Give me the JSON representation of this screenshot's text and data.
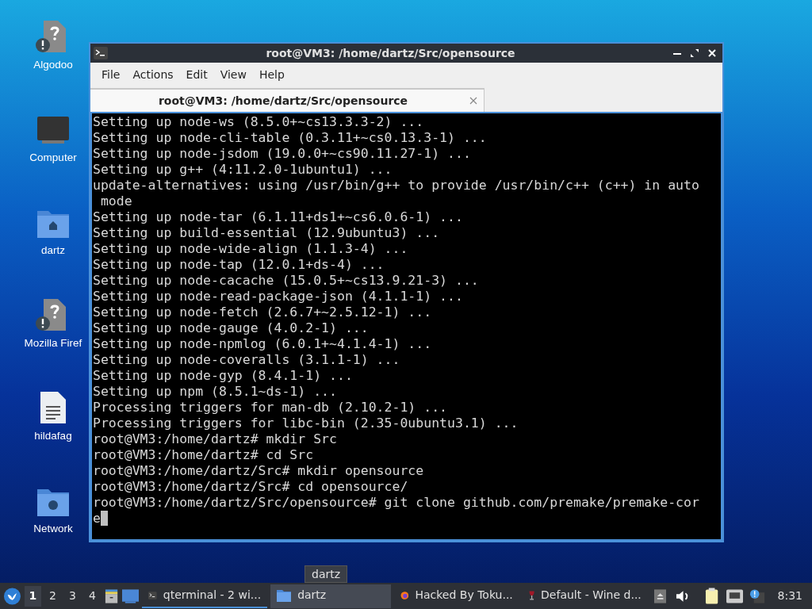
{
  "desktop_icons": [
    {
      "kind": "unknown",
      "label": "Algodoo"
    },
    {
      "kind": "computer",
      "label": "Computer"
    },
    {
      "kind": "home",
      "label": "dartz"
    },
    {
      "kind": "unknown",
      "label": "Mozilla Firef"
    },
    {
      "kind": "document",
      "label": "hildafag"
    },
    {
      "kind": "network",
      "label": "Network"
    }
  ],
  "window": {
    "title": "root@VM3: /home/dartz/Src/opensource",
    "menu": [
      "File",
      "Actions",
      "Edit",
      "View",
      "Help"
    ],
    "tabs": [
      {
        "label": "root@VM3: /home/dartz/Src/opensource",
        "selected": true
      }
    ],
    "terminal_lines": [
      "Setting up node-ws (8.5.0+~cs13.3.3-2) ...",
      "Setting up node-cli-table (0.3.11+~cs0.13.3-1) ...",
      "Setting up node-jsdom (19.0.0+~cs90.11.27-1) ...",
      "Setting up g++ (4:11.2.0-1ubuntu1) ...",
      "update-alternatives: using /usr/bin/g++ to provide /usr/bin/c++ (c++) in auto",
      " mode",
      "Setting up node-tar (6.1.11+ds1+~cs6.0.6-1) ...",
      "Setting up build-essential (12.9ubuntu3) ...",
      "Setting up node-wide-align (1.1.3-4) ...",
      "Setting up node-tap (12.0.1+ds-4) ...",
      "Setting up node-cacache (15.0.5+~cs13.9.21-3) ...",
      "Setting up node-read-package-json (4.1.1-1) ...",
      "Setting up node-fetch (2.6.7+~2.5.12-1) ...",
      "Setting up node-gauge (4.0.2-1) ...",
      "Setting up node-npmlog (6.0.1+~4.1.4-1) ...",
      "Setting up node-coveralls (3.1.1-1) ...",
      "Setting up node-gyp (8.4.1-1) ...",
      "Setting up npm (8.5.1~ds-1) ...",
      "Processing triggers for man-db (2.10.2-1) ...",
      "Processing triggers for libc-bin (2.35-0ubuntu3.1) ...",
      "root@VM3:/home/dartz# mkdir Src",
      "root@VM3:/home/dartz# cd Src",
      "root@VM3:/home/dartz/Src# mkdir opensource",
      "root@VM3:/home/dartz/Src# cd opensource/",
      "root@VM3:/home/dartz/Src/opensource# git clone github.com/premake/premake-cor",
      "e"
    ]
  },
  "taskbar": {
    "workspaces": [
      {
        "label": "1",
        "selected": true
      },
      {
        "label": "2",
        "selected": false
      },
      {
        "label": "3",
        "selected": false
      },
      {
        "label": "4",
        "selected": false
      }
    ],
    "tasks": [
      {
        "kind": "terminal",
        "label": "qterminal - 2 wi...",
        "selected": true,
        "hovered": false
      },
      {
        "kind": "folder",
        "label": "dartz",
        "selected": false,
        "hovered": true
      },
      {
        "kind": "browser",
        "label": "Hacked By Toku...",
        "selected": false,
        "hovered": false
      },
      {
        "kind": "wine",
        "label": "Default - Wine d...",
        "selected": false,
        "hovered": false
      }
    ],
    "clock": "8:31",
    "tooltip": "dartz"
  }
}
